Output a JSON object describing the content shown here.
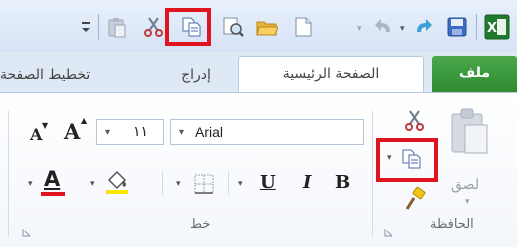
{
  "tabs": {
    "file": "ملف",
    "home": "الصفحة الرئيسية",
    "insert": "إدراج",
    "page_layout": "تخطيط الصفحة"
  },
  "ribbon": {
    "clipboard": {
      "label": "الحافظة",
      "paste_label": "لصق"
    },
    "font": {
      "label": "خط",
      "font_name": "Arial",
      "font_size": "١١",
      "grow_font": "A",
      "shrink_font": "A",
      "bold": "B",
      "italic": "I",
      "underline": "U",
      "font_color_letter": "A"
    }
  },
  "colors": {
    "highlight_box": "#e0141f",
    "file_tab": "#2e8b30",
    "font_color": "#e0141f",
    "fill_color": "#ffe600"
  },
  "icons": {
    "qat": [
      "excel-icon",
      "save-icon",
      "redo-icon",
      "undo-icon",
      "new-icon",
      "open-icon",
      "print-preview-icon",
      "copy-icon",
      "cut-icon",
      "paste-icon",
      "customize-qat-icon"
    ],
    "clipboard": [
      "paste-icon",
      "cut-icon",
      "copy-icon",
      "format-painter-icon"
    ],
    "font": [
      "borders-icon",
      "fill-color-icon"
    ]
  }
}
